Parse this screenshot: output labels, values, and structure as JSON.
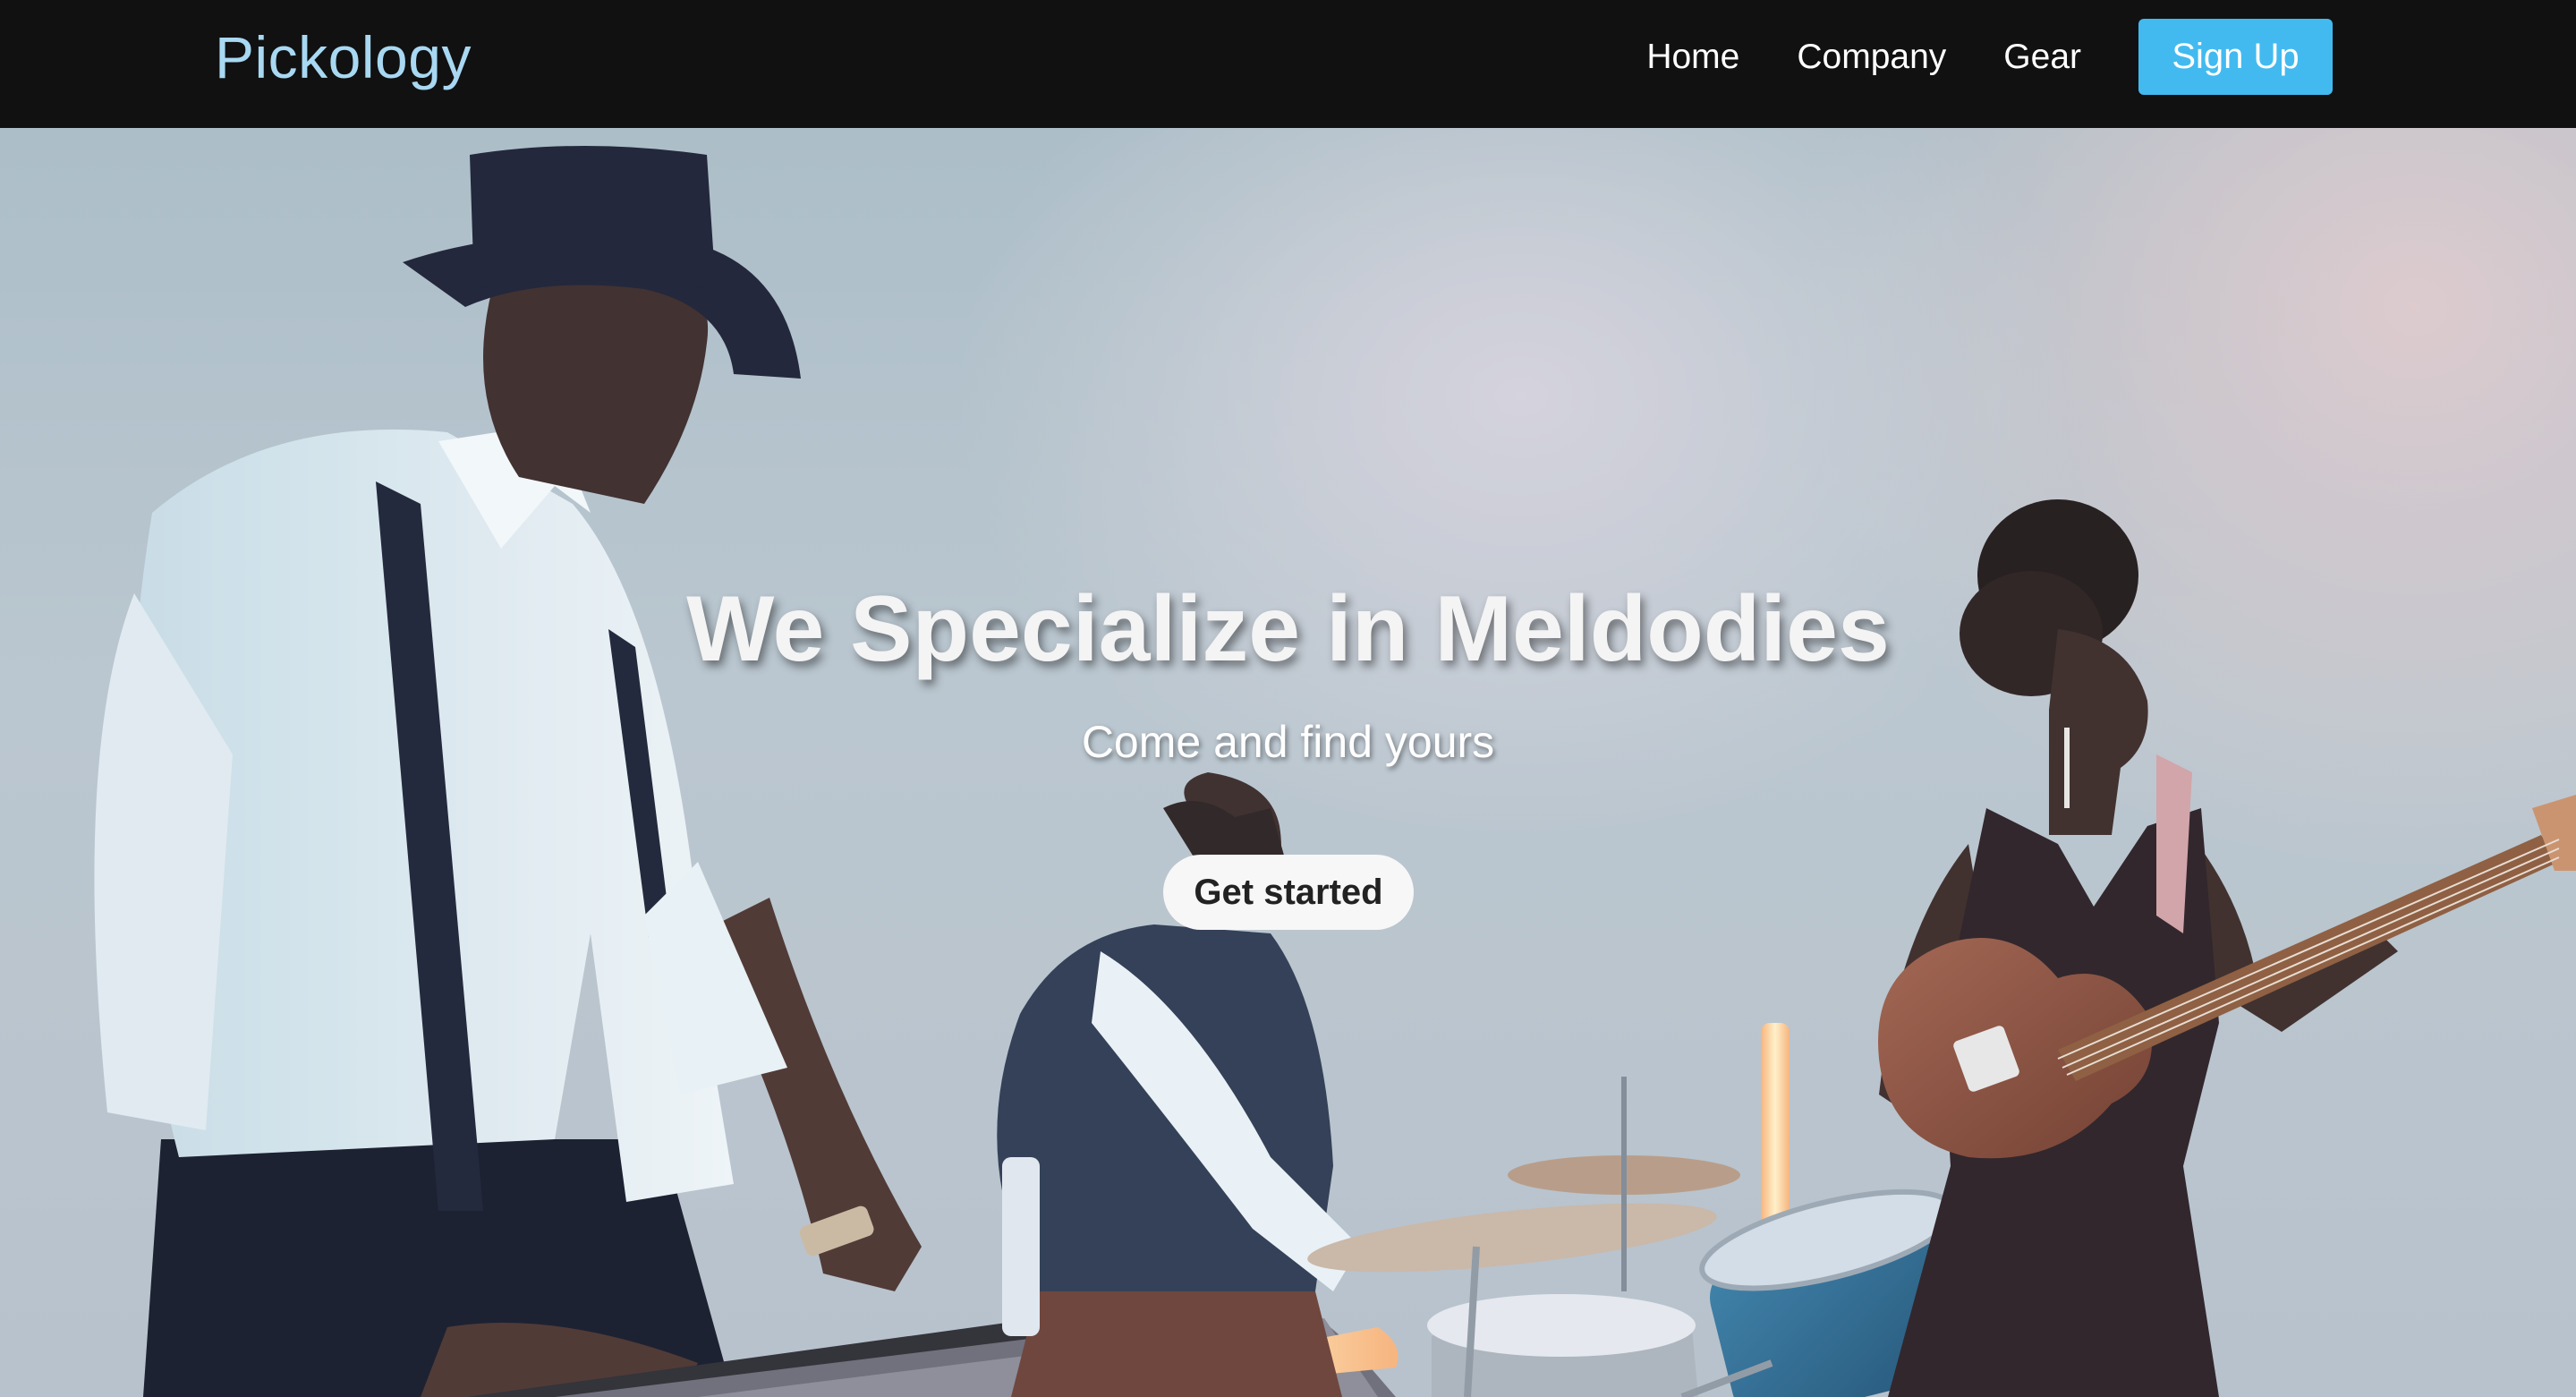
{
  "navbar": {
    "brand": "Pickology",
    "links": [
      {
        "label": "Home"
      },
      {
        "label": "Company"
      },
      {
        "label": "Gear"
      }
    ],
    "signup_label": "Sign Up"
  },
  "hero": {
    "title": "We Specialize in Meldodies",
    "subtitle": "Come and find yours",
    "cta_label": "Get started"
  },
  "colors": {
    "navbar_bg": "#111111",
    "brand": "#a8d8f2",
    "signup_button": "#42baf0",
    "cta_button": "#f7f7f7"
  }
}
